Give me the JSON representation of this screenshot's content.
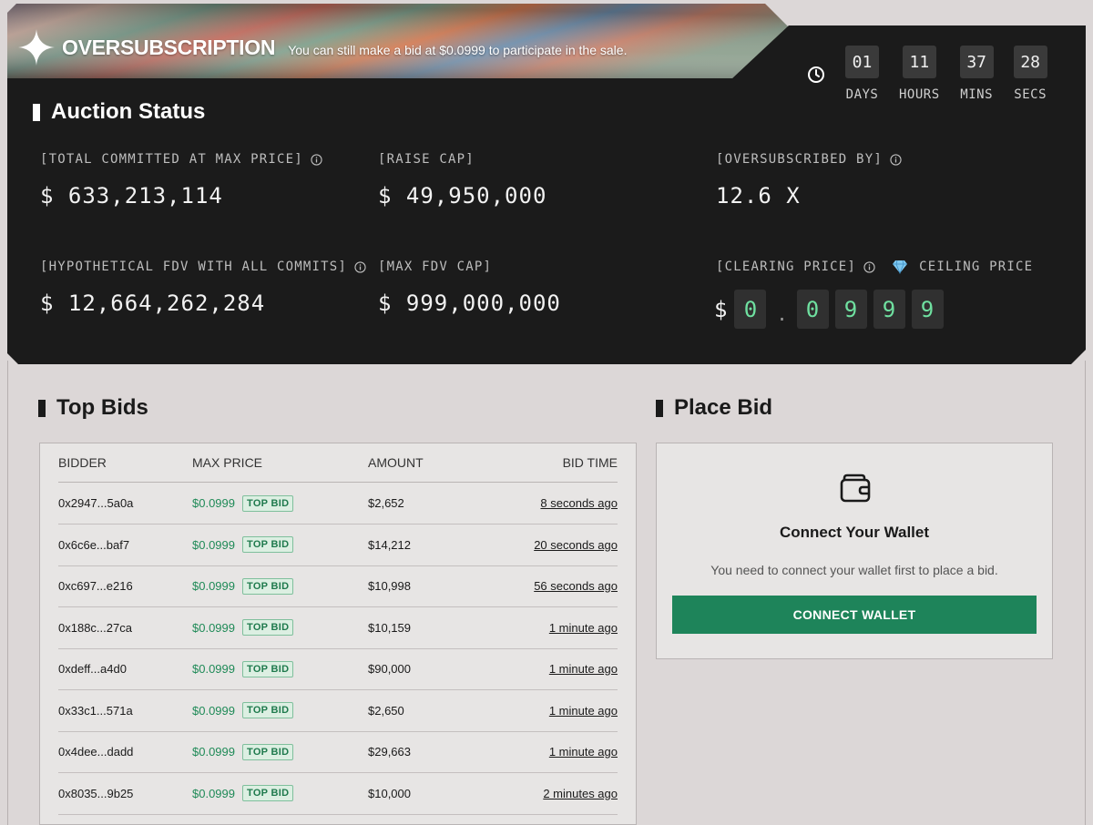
{
  "banner": {
    "title": "OVERSUBSCRIPTION",
    "message": "You can still make a bid at $0.0999 to participate in the sale."
  },
  "countdown": [
    {
      "value": "01",
      "label": "DAYS"
    },
    {
      "value": "11",
      "label": "HOURS"
    },
    {
      "value": "37",
      "label": "MINS"
    },
    {
      "value": "28",
      "label": "SECS"
    }
  ],
  "auction": {
    "title": "Auction Status",
    "total_committed": {
      "label": "[TOTAL COMMITTED AT MAX PRICE]",
      "value": "$ 633,213,114"
    },
    "raise_cap": {
      "label": "[RAISE CAP]",
      "value": "$ 49,950,000"
    },
    "oversubscribed": {
      "label": "[OVERSUBSCRIBED BY]",
      "value": "12.6 X"
    },
    "hypothetical_fdv": {
      "label": "[HYPOTHETICAL FDV WITH ALL COMMITS]",
      "value": "$ 12,664,262,284"
    },
    "max_fdv": {
      "label": "[MAX FDV CAP]",
      "value": "$ 999,000,000"
    },
    "clearing_price": {
      "label": "[CLEARING PRICE]",
      "ceiling_label": "CEILING PRICE",
      "currency": "$",
      "digits": [
        "0",
        ".",
        "0",
        "9",
        "9",
        "9"
      ]
    }
  },
  "top_bids": {
    "title": "Top Bids",
    "columns": [
      "BIDDER",
      "MAX PRICE",
      "AMOUNT",
      "BID TIME"
    ],
    "badge": "TOP BID",
    "rows": [
      {
        "bidder": "0x2947...5a0a",
        "price": "$0.0999",
        "amount": "$2,652",
        "time": "8 seconds ago"
      },
      {
        "bidder": "0x6c6e...baf7",
        "price": "$0.0999",
        "amount": "$14,212",
        "time": "20 seconds ago"
      },
      {
        "bidder": "0xc697...e216",
        "price": "$0.0999",
        "amount": "$10,998",
        "time": "56 seconds ago"
      },
      {
        "bidder": "0x188c...27ca",
        "price": "$0.0999",
        "amount": "$10,159",
        "time": "1 minute ago"
      },
      {
        "bidder": "0xdeff...a4d0",
        "price": "$0.0999",
        "amount": "$90,000",
        "time": "1 minute ago"
      },
      {
        "bidder": "0x33c1...571a",
        "price": "$0.0999",
        "amount": "$2,650",
        "time": "1 minute ago"
      },
      {
        "bidder": "0x4dee...dadd",
        "price": "$0.0999",
        "amount": "$29,663",
        "time": "1 minute ago"
      },
      {
        "bidder": "0x8035...9b25",
        "price": "$0.0999",
        "amount": "$10,000",
        "time": "2 minutes ago"
      }
    ]
  },
  "place_bid": {
    "title": "Place Bid",
    "wallet_title": "Connect Your Wallet",
    "wallet_message": "You need to connect your wallet first to place a bid.",
    "button_label": "CONNECT WALLET"
  },
  "colors": {
    "panel_dark": "#1b1b1b",
    "accent_green": "#1e845a",
    "digit_green": "#6fe0a0",
    "page_bg": "#dcd7d7"
  }
}
